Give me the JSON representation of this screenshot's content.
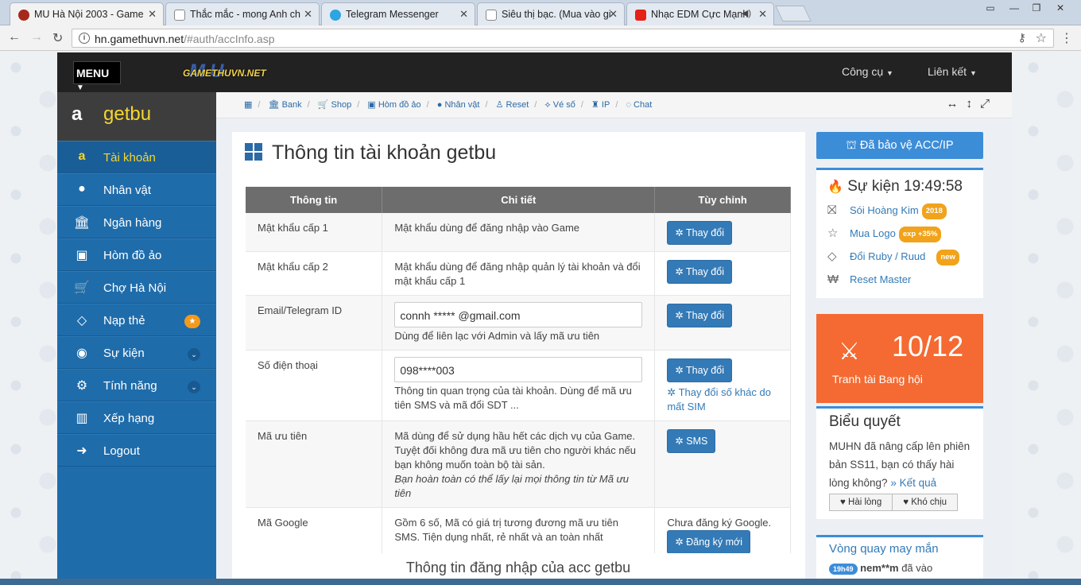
{
  "browser": {
    "tabs": [
      {
        "title": "MU Hà Nội 2003 - Game",
        "icon_color": "#c0392b"
      },
      {
        "title": "Thắc mắc - mong Anh ch",
        "icon_color": "#ddd"
      },
      {
        "title": "Telegram Messenger",
        "icon_color": "#2ca5e0"
      },
      {
        "title": "Siêu thị bạc. (Mua vào gi",
        "icon_color": "#ddd"
      },
      {
        "title": "Nhạc EDM Cực Mạnh",
        "icon_color": "#e62117"
      }
    ],
    "url_host": "hn.gamethuvn.net",
    "url_path": "/#auth/accInfo.asp"
  },
  "topnav": {
    "menu_label": "MENU",
    "logo_big": "MU",
    "logo_small": "GAMETHUVN.NET",
    "tools_label": "Công cụ",
    "links_label": "Liên kết"
  },
  "sidebar": {
    "username": "getbu",
    "items": [
      {
        "label": "Tài khoản",
        "icon": "amazon-icon"
      },
      {
        "label": "Nhân vật",
        "icon": "user-icon"
      },
      {
        "label": "Ngân hàng",
        "icon": "bank-icon"
      },
      {
        "label": "Hòm đồ ảo",
        "icon": "briefcase-icon"
      },
      {
        "label": "Chợ Hà Nội",
        "icon": "cart-icon"
      },
      {
        "label": "Nạp thẻ",
        "icon": "diamond-icon"
      },
      {
        "label": "Sự kiện",
        "icon": "android-icon"
      },
      {
        "label": "Tính năng",
        "icon": "cogs-icon"
      },
      {
        "label": "Xếp hạng",
        "icon": "bar-chart-icon"
      },
      {
        "label": "Logout",
        "icon": "sign-out-icon"
      }
    ]
  },
  "breadcrumb": [
    "Bank",
    "Shop",
    "Hòm đồ ảo",
    "Nhân vật",
    "Reset",
    "Vé số",
    "IP",
    "Chat"
  ],
  "main": {
    "title": "Thông tin tài khoản getbu",
    "headers": [
      "Thông tin",
      "Chi tiết",
      "Tùy chỉnh"
    ],
    "rows": {
      "pw1": {
        "name": "Mật khẩu cấp 1",
        "detail": "Mật khẩu dùng để đăng nhập vào Game",
        "button": "Thay đổi"
      },
      "pw2": {
        "name": "Mật khẩu cấp 2",
        "detail": "Mật khẩu dùng để đăng nhập quản lý tài khoản và đổi mật khẩu cấp 1",
        "button": "Thay đổi"
      },
      "email": {
        "name": "Email/Telegram ID",
        "value": "connh ***** @gmail.com",
        "detail": "Dùng để liên lạc với Admin và lấy mã ưu tiên",
        "button": "Thay đổi"
      },
      "phone": {
        "name": "Số điện thoại",
        "value": "098****003",
        "detail": "Thông tin quan trọng của tài khoản. Dùng để mã ưu tiên SMS và mã đổi SDT ...",
        "button": "Thay đổi",
        "link": "Thay đổi số khác do mất SIM"
      },
      "priority": {
        "name": "Mã ưu tiên",
        "detail": "Mã dùng để sử dụng hầu hết các dịch vụ của Game. Tuyệt đối không đưa mã ưu tiên cho người khác nếu bạn không muốn toàn bộ tài sản.",
        "detail_italic": "Bạn hoàn toàn có thể lấy lại mọi thông tin từ Mã ưu tiên",
        "button": "SMS"
      },
      "google": {
        "name": "Mã Google",
        "detail": "Gồm 6 số, Mã có giá trị tương đương mã ưu tiên SMS. Tiện dụng nhất, rẻ nhất và an toàn nhất",
        "status": "Chưa đăng ký Google.",
        "button": "Đăng ký mới"
      }
    },
    "footer_title": "Thông tin đăng nhập của acc getbu"
  },
  "right": {
    "protect_label": "Đã bảo vệ ACC/IP",
    "events_title": "Sự kiện 19:49:58",
    "events": [
      {
        "label": "Sói Hoàng Kim",
        "tag": "2018",
        "icon": "gift-icon"
      },
      {
        "label": "Mua Logo",
        "tag": "exp +35%",
        "icon": "star-icon"
      },
      {
        "label": "Đổi Ruby / Ruud",
        "tag": "new",
        "icon": "diamond-icon"
      },
      {
        "label": "Reset Master",
        "tag": "",
        "icon": "won-icon"
      }
    ],
    "guild_count": "10/12",
    "guild_label": "Tranh tài Bang hội",
    "poll_title": "Biểu quyết",
    "poll_text": "MUHN đã nâng cấp lên phiên bản SS11, bạn có thấy hài lòng không?",
    "poll_result": "» Kết quả",
    "poll_yes": "Hài lòng",
    "poll_no": "Khó chịu",
    "lucky_title": "Vòng quay may mắn",
    "lucky_time": "19h49",
    "lucky_name": "nem**m",
    "lucky_text": "đã vào"
  }
}
